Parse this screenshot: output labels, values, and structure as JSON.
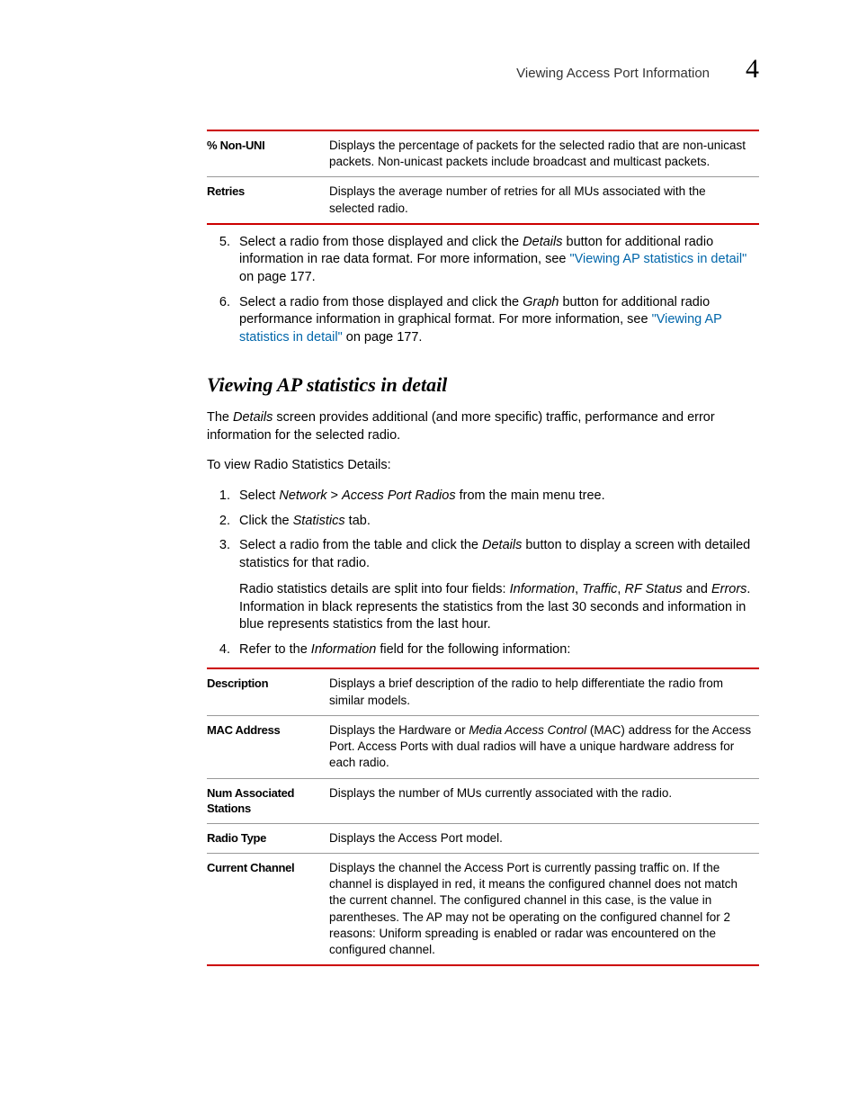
{
  "header": {
    "title": "Viewing Access Port Information",
    "chapter": "4"
  },
  "table1": {
    "rows": [
      {
        "label": "% Non-UNI",
        "desc": "Displays the percentage of packets for the selected radio that are non-unicast packets. Non-unicast packets include broadcast and multicast packets."
      },
      {
        "label": "Retries",
        "desc": "Displays the average number of retries for all MUs associated with the selected radio."
      }
    ]
  },
  "steps_a": {
    "start": 5,
    "items": [
      {
        "pre": "Select a radio from those displayed and click the ",
        "i1": "Details",
        "mid": " button for additional radio information in rae data format. For more information, see ",
        "link": "\"Viewing AP statistics in detail\"",
        "after_link": " on page 177."
      },
      {
        "pre": "Select a radio from those displayed and click the ",
        "i1": "Graph",
        "mid": " button for additional radio performance information in graphical format. For more information, see ",
        "link": "\"Viewing AP statistics in detail\"",
        "after_link": " on page 177."
      }
    ]
  },
  "section": {
    "heading": "Viewing AP statistics in detail",
    "intro_pre": "The ",
    "intro_i": "Details",
    "intro_post": " screen provides additional (and more specific) traffic, performance and error information for the selected radio.",
    "lead": "To view Radio Statistics Details:"
  },
  "steps_b": {
    "start": 1,
    "items": [
      {
        "text_parts": [
          "Select ",
          "Network",
          " > ",
          "Access Port Radios",
          " from the main menu tree."
        ],
        "italics": [
          1,
          3
        ]
      },
      {
        "text_parts": [
          "Click the ",
          "Statistics",
          " tab."
        ],
        "italics": [
          1
        ]
      },
      {
        "text_parts": [
          "Select a radio from the table and click the ",
          "Details",
          " button to display a screen with detailed statistics for that radio."
        ],
        "italics": [
          1
        ],
        "sub_pre": "Radio statistics details are split into four fields: ",
        "sub_fields": [
          "Information",
          ", ",
          "Traffic",
          ", ",
          "RF Status",
          " and ",
          "Errors"
        ],
        "sub_fields_italics": [
          0,
          2,
          4,
          6
        ],
        "sub_post": ". Information in black represents the statistics from the last 30 seconds and information in blue represents statistics from the last hour."
      },
      {
        "text_parts": [
          "Refer to the ",
          "Information",
          " field for the following information:"
        ],
        "italics": [
          1
        ]
      }
    ]
  },
  "table2": {
    "rows": [
      {
        "label": "Description",
        "desc": "Displays a brief description of the radio to help differentiate the radio from similar models."
      },
      {
        "label": "MAC Address",
        "desc_pre": "Displays the Hardware or ",
        "desc_i": "Media Access Control",
        "desc_post": " (MAC) address for the Access Port. Access Ports with dual radios will have a unique hardware address for each radio."
      },
      {
        "label": "Num Associated Stations",
        "desc": "Displays the number of MUs currently associated with the radio."
      },
      {
        "label": "Radio Type",
        "desc": "Displays the Access Port model."
      },
      {
        "label": "Current Channel",
        "desc": "Displays the channel the Access Port is currently passing traffic on. If the channel is displayed in red, it means the configured channel does not match the current channel. The configured channel in this case, is the value in parentheses. The AP may not be operating on the configured channel for 2 reasons: Uniform spreading is enabled or radar was encountered on the configured channel."
      }
    ]
  }
}
